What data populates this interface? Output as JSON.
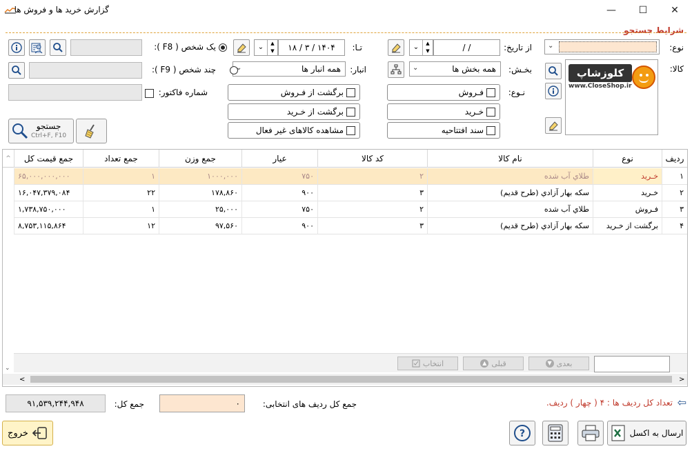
{
  "window": {
    "title": "گزارش خرید ها و فروش ها",
    "minimize": "—",
    "maximize": "☐",
    "close": "✕"
  },
  "search_section": {
    "title": "شرایط جستجو",
    "type_label": "نوع:",
    "type_value": "",
    "product_label": "کالا:",
    "logo_text": "کلوزشاپ",
    "logo_url": "www.CloseShop.ir",
    "from_date_label": "از تاریخ:",
    "from_date_value": "/    /",
    "to_date_label": "تـا:",
    "to_date_value": "۱۸ / ۳ / ۱۴۰۴",
    "section_label": "بخـش:",
    "section_value": "همه بخش ها",
    "warehouse_label": "انبار:",
    "warehouse_value": "همه انبار ها",
    "kind_label": "نـوع:",
    "one_person_label": "یک شخص ( F8 ):",
    "multi_person_label": "چند شخص ( F9 ):",
    "invoice_label": "شماره فاکتور:",
    "options": {
      "sale": "فـروش",
      "purchase": "خـرید",
      "opening_doc": "سند افتتاحیه",
      "return_sale": "برگشت از فـروش",
      "return_purchase": "برگشت از خـرید",
      "inactive_goods": "مشاهده کالاهای غیر فعال"
    },
    "search_button": "جستجو",
    "search_shortcut": "Ctrl+F, F10"
  },
  "grid": {
    "headers": {
      "row": "ردیف",
      "type": "نوع",
      "name": "نام کالا",
      "code": "کد کالا",
      "karat": "عیار",
      "weight": "جمع وزن",
      "count": "جمع تعداد",
      "price": "جمع قیمت کل"
    },
    "rows": [
      {
        "row": "۱",
        "type": "خـرید",
        "name": "طلاي آب شده",
        "code": "۲",
        "karat": "۷۵۰",
        "weight": "۱۰۰۰,۰۰۰",
        "count": "۱",
        "price": "۶۵,۰۰۰,۰۰۰,۰۰۰"
      },
      {
        "row": "۲",
        "type": "خـرید",
        "name": "سکه بهار آزادي (طرح قديم)",
        "code": "۳",
        "karat": "۹۰۰",
        "weight": "۱۷۸,۸۶۰",
        "count": "۲۲",
        "price": "۱۶,۰۴۷,۳۷۹,۰۸۴"
      },
      {
        "row": "۳",
        "type": "فـروش",
        "name": "طلاي آب شده",
        "code": "۲",
        "karat": "۷۵۰",
        "weight": "۲۵,۰۰۰",
        "count": "۱",
        "price": "۱,۷۳۸,۷۵۰,۰۰۰"
      },
      {
        "row": "۴",
        "type": "برگشت از خـرید",
        "name": "سکه بهار آزادي (طرح قديم)",
        "code": "۳",
        "karat": "۹۰۰",
        "weight": "۹۷,۵۶۰",
        "count": "۱۲",
        "price": "۸,۷۵۳,۱۱۵,۸۶۴"
      }
    ],
    "next_label": "بعدی",
    "prev_label": "قبلی",
    "select_label": "انتخاب"
  },
  "footer": {
    "total_label": "جمع کل:",
    "total_value": "۹۱,۵۳۹,۲۴۴,۹۴۸",
    "selected_total_label": "جمع کل ردیف های انتخابی:",
    "selected_total_value": "۰",
    "row_count_text": "تعداد کل ردیف ها : ۴ ( چهار ) ردیف.",
    "exit_label": "خروج",
    "excel_label": "ارسال به اکسل"
  },
  "colors": {
    "accent_red": "#c0392b",
    "selection": "#fde9c3",
    "peach_field": "#fde6d0"
  }
}
